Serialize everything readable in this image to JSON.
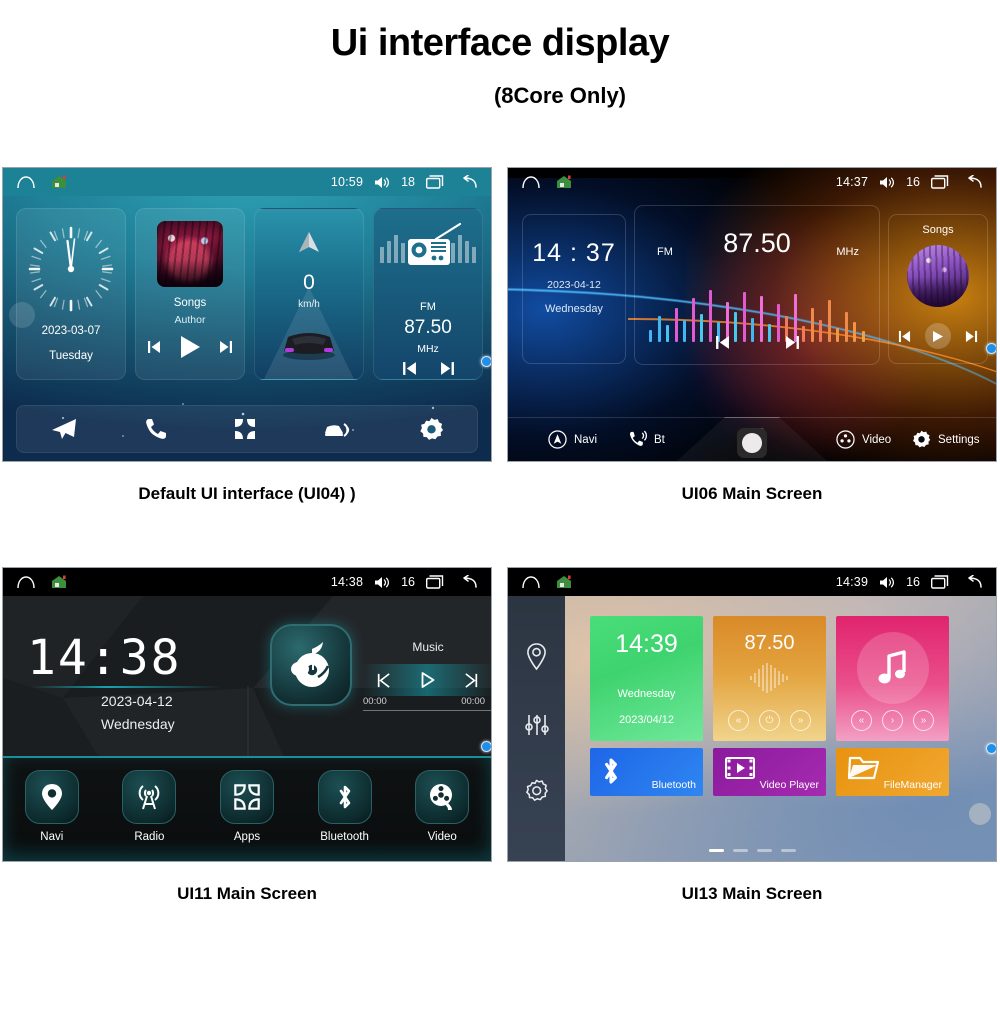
{
  "header": {
    "title": "Ui interface display",
    "subtitle": "(8Core Only)"
  },
  "panels": [
    {
      "id": "ui04",
      "caption": "Default UI interface (UI04) )",
      "statusbar": {
        "home_icon": "home-outline-icon",
        "house_icon": "house-app-icon",
        "time": "10:59",
        "volume_icon": "volume-icon",
        "volume": "18",
        "recents_icon": "recents-icon",
        "back_icon": "back-icon"
      },
      "widgets": {
        "clock": {
          "date": "2023-03-07",
          "day": "Tuesday"
        },
        "music": {
          "title": "Songs",
          "author": "Author",
          "prev_icon": "previous-track-icon",
          "play_icon": "play-icon",
          "next_icon": "next-track-icon"
        },
        "nav": {
          "speed": "0",
          "unit": "km/h",
          "arrow_icon": "navigation-arrow-icon"
        },
        "radio": {
          "band": "FM",
          "frequency": "87.50",
          "unit": "MHz",
          "prev_icon": "previous-station-icon",
          "next_icon": "next-station-icon"
        }
      },
      "dock": [
        {
          "name": "navigation",
          "icon": "paper-plane-icon"
        },
        {
          "name": "phone",
          "icon": "phone-icon"
        },
        {
          "name": "apps",
          "icon": "apps-grid-icon"
        },
        {
          "name": "carplay",
          "icon": "car-link-icon"
        },
        {
          "name": "settings",
          "icon": "gear-icon"
        }
      ]
    },
    {
      "id": "ui06",
      "caption": "UI06 Main Screen",
      "statusbar": {
        "home_icon": "home-outline-icon",
        "house_icon": "house-app-icon",
        "time": "14:37",
        "volume_icon": "volume-icon",
        "volume": "16",
        "recents_icon": "recents-icon",
        "back_icon": "back-icon"
      },
      "widgets": {
        "clock": {
          "time": "14 : 37",
          "date": "2023-04-12",
          "day": "Wednesday"
        },
        "radio": {
          "band": "FM",
          "frequency": "87.50",
          "unit": "MHz",
          "prev_icon": "previous-station-icon",
          "next_icon": "next-station-icon"
        },
        "music": {
          "title": "Songs",
          "prev_icon": "previous-track-icon",
          "play_icon": "play-icon",
          "next_icon": "next-track-icon"
        }
      },
      "navbar": [
        {
          "label": "Navi",
          "icon": "navi-circle-icon"
        },
        {
          "label": "Bt",
          "icon": "bluetooth-phone-icon"
        },
        {
          "label": "Video",
          "icon": "video-circle-icon"
        },
        {
          "label": "Settings",
          "icon": "gear-icon"
        }
      ],
      "center": {
        "apps_icon": "apps-dots-icon",
        "home_button_icon": "home-button-icon"
      }
    },
    {
      "id": "ui11",
      "caption": "UI11 Main Screen",
      "statusbar": {
        "home_icon": "home-outline-icon",
        "house_icon": "house-app-icon",
        "time": "14:38",
        "volume_icon": "volume-icon",
        "volume": "16",
        "recents_icon": "recents-icon",
        "back_icon": "back-icon"
      },
      "widgets": {
        "clock": {
          "time": "14:38",
          "date": "2023-04-12",
          "day": "Wednesday"
        },
        "music": {
          "label": "Music",
          "elapsed": "00:00",
          "total": "00:00",
          "app_icon": "music-note-disc-icon",
          "prev_icon": "previous-track-icon",
          "play_icon": "play-icon",
          "next_icon": "next-track-icon"
        }
      },
      "dock": [
        {
          "label": "Navi",
          "icon": "map-pin-icon"
        },
        {
          "label": "Radio",
          "icon": "radio-tower-icon"
        },
        {
          "label": "Apps",
          "icon": "apps-grid-icon"
        },
        {
          "label": "Bluetooth",
          "icon": "bluetooth-icon"
        },
        {
          "label": "Video",
          "icon": "film-reel-icon"
        }
      ]
    },
    {
      "id": "ui13",
      "caption": "UI13 Main Screen",
      "statusbar": {
        "home_icon": "home-outline-icon",
        "house_icon": "house-app-icon",
        "time": "14:39",
        "volume_icon": "volume-icon",
        "volume": "16",
        "recents_icon": "recents-icon",
        "back_icon": "back-icon"
      },
      "sidebar": [
        {
          "name": "navigation",
          "icon": "map-pin-outline-icon"
        },
        {
          "name": "equalizer",
          "icon": "sliders-icon"
        },
        {
          "name": "settings",
          "icon": "gear-outline-icon"
        }
      ],
      "tiles": {
        "clock": {
          "time": "14:39",
          "day": "Wednesday",
          "date": "2023/04/12",
          "color": "#4ade7a"
        },
        "radio": {
          "frequency": "87.50",
          "color": "#e3a33e",
          "prev_icon": "rewind-icon",
          "power_icon": "power-icon",
          "next_icon": "fast-forward-icon"
        },
        "music": {
          "icon": "music-note-icon",
          "color": "#e0246e",
          "prev_icon": "rewind-icon",
          "play_icon": "play-icon",
          "next_icon": "fast-forward-icon"
        },
        "bluetooth": {
          "label": "Bluetooth",
          "icon": "bluetooth-icon",
          "color": "#1e66e8"
        },
        "video_player": {
          "label": "Video Player",
          "icon": "video-film-icon",
          "color": "#8b1a9c"
        },
        "file_manager": {
          "label": "FileManager",
          "icon": "folder-icon",
          "color": "#e8920f"
        }
      },
      "page_dots": {
        "count": 4,
        "active": 0
      }
    }
  ]
}
